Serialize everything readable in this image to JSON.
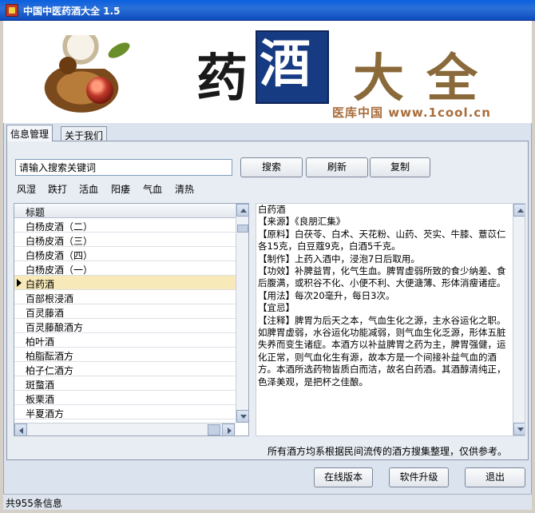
{
  "window": {
    "title": "中国中医药酒大全 1.5"
  },
  "banner": {
    "characters": [
      "药",
      "酒",
      "大",
      "全"
    ],
    "brand_text": "医库中国 www.1cool.cn"
  },
  "tabs": [
    {
      "label": "信息管理",
      "active": true
    },
    {
      "label": "关于我们",
      "active": false
    }
  ],
  "search": {
    "value": "请输入搜索关键词",
    "search_label": "搜索",
    "refresh_label": "刷新",
    "copy_label": "复制"
  },
  "categories": [
    "风湿",
    "跌打",
    "活血",
    "阳痿",
    "气血",
    "清热"
  ],
  "grid": {
    "header": "标题",
    "rows": [
      {
        "label": "白杨皮酒（二）"
      },
      {
        "label": "白杨皮酒（三）"
      },
      {
        "label": "白杨皮酒（四）"
      },
      {
        "label": "白杨皮酒（一）"
      },
      {
        "label": "白药酒",
        "selected": true
      },
      {
        "label": "百部根浸酒"
      },
      {
        "label": "百灵藤酒"
      },
      {
        "label": "百灵藤酿酒方"
      },
      {
        "label": "柏叶酒"
      },
      {
        "label": "柏脂酝酒方"
      },
      {
        "label": "柏子仁酒方"
      },
      {
        "label": "斑蝥酒"
      },
      {
        "label": "板栗酒"
      },
      {
        "label": "半夏酒方"
      }
    ]
  },
  "detail": {
    "text": "白药酒\n【来源】《良朋汇集》\n【原料】白茯苓、白术、天花粉、山药、芡实、牛膝、薏苡仁各15克，白豆蔻9克，白酒5千克。\n【制作】上药入酒中，浸泡7日后取用。\n【功效】补脾益胃，化气生血。脾胃虚弱所致的食少纳差、食后腹满，或积谷不化、小便不利、大便溏薄、形体消瘦诸症。\n【用法】每次20毫升，每日3次。\n【宜忌】\n【注释】脾胃为后天之本，气血生化之源，主水谷运化之职。如脾胃虚弱，水谷运化功能减弱，则气血生化乏源，形体五脏失养而变生诸症。本酒方以补益脾胃之药为主，脾胃强健，运化正常，则气血化生有源，故本方是一个间接补益气血的酒方。本酒所选药物皆质白而洁，故名白药酒。其酒醇清纯正，色泽美观，是把杯之佳酿。"
  },
  "note": "所有酒方均系根据民间流传的酒方搜集整理，仅供参考。",
  "buttons": {
    "online_label": "在线版本",
    "upgrade_label": "软件升级",
    "exit_label": "退出"
  },
  "status": {
    "count_text": "共955条信息"
  },
  "colors": {
    "titlebar": "#2b71d8",
    "selected_row": "#f7e9b8",
    "banner_blue": "#173b83",
    "brand_brown": "#a86d3c"
  }
}
